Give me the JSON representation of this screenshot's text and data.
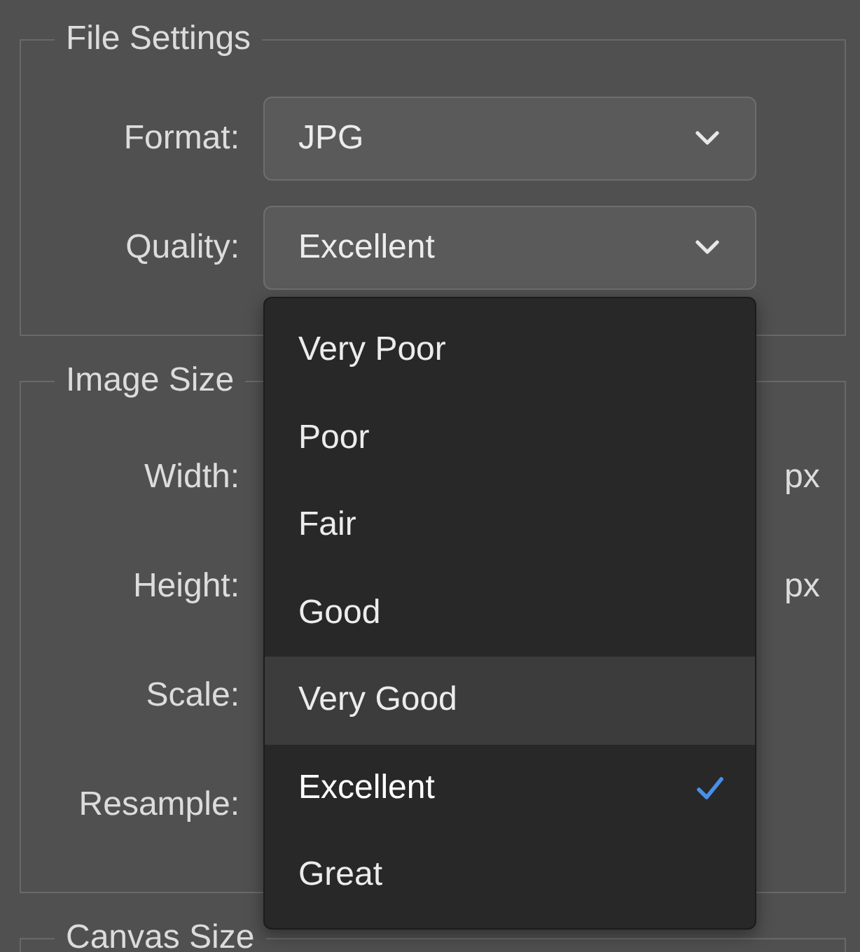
{
  "sections": [
    {
      "title": "File Settings",
      "rows": [
        {
          "label": "Format:",
          "kind": "select",
          "value": "JPG"
        },
        {
          "label": "Quality:",
          "kind": "select",
          "value": "Excellent"
        }
      ]
    },
    {
      "title": "Image Size",
      "rows": [
        {
          "label": "Width:",
          "kind": "covered",
          "unit": "px"
        },
        {
          "label": "Height:",
          "kind": "covered",
          "unit": "px"
        },
        {
          "label": "Scale:",
          "kind": "covered"
        },
        {
          "label": "Resample:",
          "kind": "covered"
        }
      ]
    },
    {
      "title": "Canvas Size"
    }
  ],
  "dropdown": {
    "options": [
      {
        "label": "Very Poor",
        "selected": false,
        "hovered": false
      },
      {
        "label": "Poor",
        "selected": false,
        "hovered": false
      },
      {
        "label": "Fair",
        "selected": false,
        "hovered": false
      },
      {
        "label": "Good",
        "selected": false,
        "hovered": false
      },
      {
        "label": "Very Good",
        "selected": false,
        "hovered": true
      },
      {
        "label": "Excellent",
        "selected": true,
        "hovered": false
      },
      {
        "label": "Great",
        "selected": false,
        "hovered": false
      }
    ]
  }
}
